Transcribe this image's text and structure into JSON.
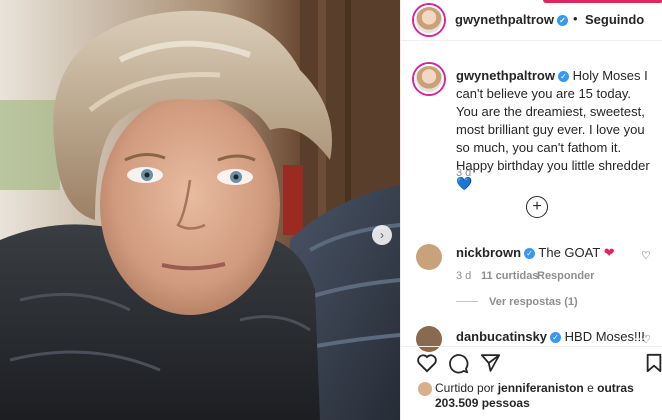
{
  "post": {
    "username": "gwynethpaltrow",
    "follow_state": "Seguindo",
    "dot": "•",
    "caption": "Holy Moses I can't believe you are 15 today. You are the dreamiest, sweetest, most brilliant guy ever. I love you so much, you can't fathom it. Happy birthday you little shredder",
    "caption_emoji": "💙",
    "time": "3 d"
  },
  "comments": [
    {
      "username": "nickbrown",
      "text": "The GOAT",
      "emoji": "❤",
      "time": "3 d",
      "likes": "11 curtidas",
      "reply": "Responder",
      "view_replies": "Ver respostas (1)"
    },
    {
      "username": "danbucatinsky",
      "text": "HBD Moses!!!"
    }
  ],
  "liked_by": {
    "prefix": "Curtido por",
    "user": "jenniferaniston",
    "connector": "e",
    "others": "outras 203.509 pessoas"
  },
  "icons": {
    "verified": "✓",
    "add": "+",
    "heart": "♡",
    "next": "›"
  },
  "colors": {
    "verified": "#3897f0",
    "accent_red": "#e0245e"
  }
}
